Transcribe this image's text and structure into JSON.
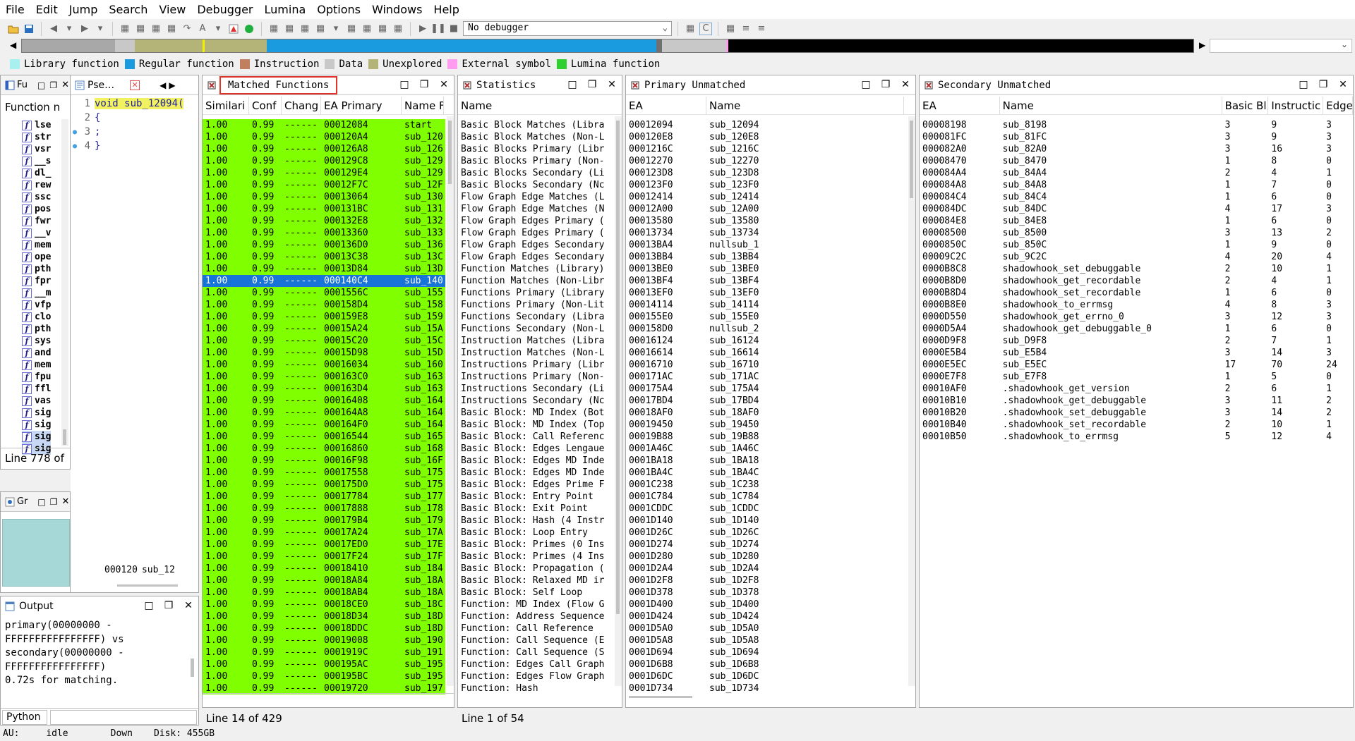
{
  "menu": [
    "File",
    "Edit",
    "Jump",
    "Search",
    "View",
    "Debugger",
    "Lumina",
    "Options",
    "Windows",
    "Help"
  ],
  "toolbar": {
    "debugger_value": "No debugger"
  },
  "legend": [
    {
      "label": "Library function",
      "color": "#a8f0f0"
    },
    {
      "label": "Regular function",
      "color": "#1a9be0"
    },
    {
      "label": "Instruction",
      "color": "#c08060"
    },
    {
      "label": "Data",
      "color": "#c8c8c8"
    },
    {
      "label": "Unexplored",
      "color": "#b4b478"
    },
    {
      "label": "External symbol",
      "color": "#ff9cf0"
    },
    {
      "label": "Lumina function",
      "color": "#30d030"
    }
  ],
  "colors": {
    "match_green": "#80ff00",
    "selected_blue": "#1874d6",
    "highlight_red": "#e0342a",
    "nav_blue": "#1a9be0",
    "nav_olive": "#b4b478"
  },
  "functions_panel": {
    "tab": "Fu",
    "header": "Function n",
    "items": [
      "lse",
      "str",
      "vsr",
      "__s",
      "dl_",
      "rew",
      "ssc",
      "pos",
      "fwr",
      "__v",
      "mem",
      "ope",
      "pth",
      "fpr",
      "__m",
      "vfp",
      "clo",
      "pth",
      "sys",
      "and",
      "mem",
      "fpu",
      "ffl",
      "vas",
      "sig",
      "sig",
      "sig",
      "sig"
    ],
    "status": "Line 778 of"
  },
  "graph_panel": {
    "tab": "Gr"
  },
  "pseudo_panel": {
    "tab": "Pse…",
    "lines": [
      {
        "num": "1",
        "code": "void sub_12094("
      },
      {
        "num": "2",
        "code": "{"
      },
      {
        "num": "3",
        "code": "  ;"
      },
      {
        "num": "4",
        "code": "}"
      }
    ],
    "footer_addr": "000120",
    "footer_name": "sub_12"
  },
  "output_panel": {
    "title": "Output",
    "lines": [
      "primary(00000000 -",
      "FFFFFFFFFFFFFFFF) vs",
      "secondary(00000000 -",
      "FFFFFFFFFFFFFFFF)",
      "0.72s for matching."
    ],
    "input_label": "Python"
  },
  "matched": {
    "title": "Matched Functions",
    "columns": [
      "Similari",
      "Conf",
      "Chang",
      "EA Primary",
      "Name F"
    ],
    "rows": [
      [
        "1.00",
        "0.99",
        "------",
        "00012084",
        "start"
      ],
      [
        "1.00",
        "0.99",
        "------",
        "000120A4",
        "sub_120"
      ],
      [
        "1.00",
        "0.99",
        "------",
        "000126A8",
        "sub_126"
      ],
      [
        "1.00",
        "0.99",
        "------",
        "000129C8",
        "sub_129"
      ],
      [
        "1.00",
        "0.99",
        "------",
        "000129E4",
        "sub_129"
      ],
      [
        "1.00",
        "0.99",
        "------",
        "00012F7C",
        "sub_12F"
      ],
      [
        "1.00",
        "0.99",
        "------",
        "00013064",
        "sub_130"
      ],
      [
        "1.00",
        "0.99",
        "------",
        "000131BC",
        "sub_131"
      ],
      [
        "1.00",
        "0.99",
        "------",
        "000132E8",
        "sub_132"
      ],
      [
        "1.00",
        "0.99",
        "------",
        "00013360",
        "sub_133"
      ],
      [
        "1.00",
        "0.99",
        "------",
        "000136D0",
        "sub_136"
      ],
      [
        "1.00",
        "0.99",
        "------",
        "00013C38",
        "sub_13C"
      ],
      [
        "1.00",
        "0.99",
        "------",
        "00013D84",
        "sub_13D"
      ],
      [
        "1.00",
        "0.99",
        "------",
        "000140C4",
        "sub_140"
      ],
      [
        "1.00",
        "0.99",
        "------",
        "0001556C",
        "sub_155"
      ],
      [
        "1.00",
        "0.99",
        "------",
        "000158D4",
        "sub_158"
      ],
      [
        "1.00",
        "0.99",
        "------",
        "000159E8",
        "sub_159"
      ],
      [
        "1.00",
        "0.99",
        "------",
        "00015A24",
        "sub_15A"
      ],
      [
        "1.00",
        "0.99",
        "------",
        "00015C20",
        "sub_15C"
      ],
      [
        "1.00",
        "0.99",
        "------",
        "00015D98",
        "sub_15D"
      ],
      [
        "1.00",
        "0.99",
        "------",
        "00016034",
        "sub_160"
      ],
      [
        "1.00",
        "0.99",
        "------",
        "000163C0",
        "sub_163"
      ],
      [
        "1.00",
        "0.99",
        "------",
        "000163D4",
        "sub_163"
      ],
      [
        "1.00",
        "0.99",
        "------",
        "00016408",
        "sub_164"
      ],
      [
        "1.00",
        "0.99",
        "------",
        "000164A8",
        "sub_164"
      ],
      [
        "1.00",
        "0.99",
        "------",
        "000164F0",
        "sub_164"
      ],
      [
        "1.00",
        "0.99",
        "------",
        "00016544",
        "sub_165"
      ],
      [
        "1.00",
        "0.99",
        "------",
        "00016860",
        "sub_168"
      ],
      [
        "1.00",
        "0.99",
        "------",
        "00016F98",
        "sub_16F"
      ],
      [
        "1.00",
        "0.99",
        "------",
        "00017558",
        "sub_175"
      ],
      [
        "1.00",
        "0.99",
        "------",
        "000175D0",
        "sub_175"
      ],
      [
        "1.00",
        "0.99",
        "------",
        "00017784",
        "sub_177"
      ],
      [
        "1.00",
        "0.99",
        "------",
        "00017888",
        "sub_178"
      ],
      [
        "1.00",
        "0.99",
        "------",
        "000179B4",
        "sub_179"
      ],
      [
        "1.00",
        "0.99",
        "------",
        "00017A24",
        "sub_17A"
      ],
      [
        "1.00",
        "0.99",
        "------",
        "00017ED0",
        "sub_17E"
      ],
      [
        "1.00",
        "0.99",
        "------",
        "00017F24",
        "sub_17F"
      ],
      [
        "1.00",
        "0.99",
        "------",
        "00018410",
        "sub_184"
      ],
      [
        "1.00",
        "0.99",
        "------",
        "00018A84",
        "sub_18A"
      ],
      [
        "1.00",
        "0.99",
        "------",
        "00018AB4",
        "sub_18A"
      ],
      [
        "1.00",
        "0.99",
        "------",
        "00018CE0",
        "sub_18C"
      ],
      [
        "1.00",
        "0.99",
        "------",
        "00018D34",
        "sub_18D"
      ],
      [
        "1.00",
        "0.99",
        "------",
        "00018DDC",
        "sub_18D"
      ],
      [
        "1.00",
        "0.99",
        "------",
        "00019008",
        "sub_190"
      ],
      [
        "1.00",
        "0.99",
        "------",
        "0001919C",
        "sub_191"
      ],
      [
        "1.00",
        "0.99",
        "------",
        "000195AC",
        "sub_195"
      ],
      [
        "1.00",
        "0.99",
        "------",
        "000195BC",
        "sub_195"
      ],
      [
        "1.00",
        "0.99",
        "------",
        "00019720",
        "sub_197"
      ]
    ],
    "selected_index": 13,
    "status": "Line 14 of 429"
  },
  "statistics": {
    "title": "Statistics",
    "column": "Name",
    "rows": [
      "Basic Block Matches (Libra",
      "Basic Block Matches (Non-L",
      "Basic Blocks Primary (Libr",
      "Basic Blocks Primary (Non-",
      "Basic Blocks Secondary (Li",
      "Basic Blocks Secondary (Nc",
      "Flow Graph Edge Matches (L",
      "Flow Graph Edge Matches (N",
      "Flow Graph Edges Primary (",
      "Flow Graph Edges Primary (",
      "Flow Graph Edges Secondary",
      "Flow Graph Edges Secondary",
      "Function Matches (Library)",
      "Function Matches (Non-Libr",
      "Functions Primary (Library",
      "Functions Primary (Non-Lit",
      "Functions Secondary (Libra",
      "Functions Secondary (Non-L",
      "Instruction Matches (Libra",
      "Instruction Matches (Non-L",
      "Instructions Primary (Libr",
      "Instructions Primary (Non-",
      "Instructions Secondary (Li",
      "Instructions Secondary (Nc",
      "Basic Block: MD Index (Bot",
      "Basic Block: MD Index (Top",
      "Basic Block: Call Referenc",
      "Basic Block: Edges Lengaue",
      "Basic Block: Edges MD Inde",
      "Basic Block: Edges MD Inde",
      "Basic Block: Edges Prime F",
      "Basic Block: Entry Point",
      "Basic Block: Exit Point",
      "Basic Block: Hash (4 Instr",
      "Basic Block: Loop Entry",
      "Basic Block: Primes (0 Ins",
      "Basic Block: Primes (4 Ins",
      "Basic Block: Propagation (",
      "Basic Block: Relaxed MD ir",
      "Basic Block: Self Loop",
      "Function: MD Index (Flow G",
      "Function: Address Sequence",
      "Function: Call Reference",
      "Function: Call Sequence (E",
      "Function: Call Sequence (S",
      "Function: Edges Call Graph",
      "Function: Edges Flow Graph",
      "Function: Hash"
    ],
    "status": "Line 1 of 54"
  },
  "primary_unmatched": {
    "title": "Primary Unmatched",
    "columns": [
      "EA",
      "Name"
    ],
    "rows": [
      [
        "00012094",
        "sub_12094"
      ],
      [
        "000120E8",
        "sub_120E8"
      ],
      [
        "0001216C",
        "sub_1216C"
      ],
      [
        "00012270",
        "sub_12270"
      ],
      [
        "000123D8",
        "sub_123D8"
      ],
      [
        "000123F0",
        "sub_123F0"
      ],
      [
        "00012414",
        "sub_12414"
      ],
      [
        "00012A00",
        "sub_12A00"
      ],
      [
        "00013580",
        "sub_13580"
      ],
      [
        "00013734",
        "sub_13734"
      ],
      [
        "00013BA4",
        "nullsub_1"
      ],
      [
        "00013BB4",
        "sub_13BB4"
      ],
      [
        "00013BE0",
        "sub_13BE0"
      ],
      [
        "00013BF4",
        "sub_13BF4"
      ],
      [
        "00013EF0",
        "sub_13EF0"
      ],
      [
        "00014114",
        "sub_14114"
      ],
      [
        "000155E0",
        "sub_155E0"
      ],
      [
        "000158D0",
        "nullsub_2"
      ],
      [
        "00016124",
        "sub_16124"
      ],
      [
        "00016614",
        "sub_16614"
      ],
      [
        "00016710",
        "sub_16710"
      ],
      [
        "000171AC",
        "sub_171AC"
      ],
      [
        "000175A4",
        "sub_175A4"
      ],
      [
        "00017BD4",
        "sub_17BD4"
      ],
      [
        "00018AF0",
        "sub_18AF0"
      ],
      [
        "00019450",
        "sub_19450"
      ],
      [
        "00019B88",
        "sub_19B88"
      ],
      [
        "0001A46C",
        "sub_1A46C"
      ],
      [
        "0001BA18",
        "sub_1BA18"
      ],
      [
        "0001BA4C",
        "sub_1BA4C"
      ],
      [
        "0001C238",
        "sub_1C238"
      ],
      [
        "0001C784",
        "sub_1C784"
      ],
      [
        "0001CDDC",
        "sub_1CDDC"
      ],
      [
        "0001D140",
        "sub_1D140"
      ],
      [
        "0001D26C",
        "sub_1D26C"
      ],
      [
        "0001D274",
        "sub_1D274"
      ],
      [
        "0001D280",
        "sub_1D280"
      ],
      [
        "0001D2A4",
        "sub_1D2A4"
      ],
      [
        "0001D2F8",
        "sub_1D2F8"
      ],
      [
        "0001D378",
        "sub_1D378"
      ],
      [
        "0001D400",
        "sub_1D400"
      ],
      [
        "0001D424",
        "sub_1D424"
      ],
      [
        "0001D5A0",
        "sub_1D5A0"
      ],
      [
        "0001D5A8",
        "sub_1D5A8"
      ],
      [
        "0001D694",
        "sub_1D694"
      ],
      [
        "0001D6B8",
        "sub_1D6B8"
      ],
      [
        "0001D6DC",
        "sub_1D6DC"
      ],
      [
        "0001D734",
        "sub_1D734"
      ]
    ]
  },
  "secondary_unmatched": {
    "title": "Secondary Unmatched",
    "columns": [
      "EA",
      "Name",
      "Basic Bl",
      "Instructic",
      "Edges"
    ],
    "rows": [
      [
        "00008198",
        "sub_8198",
        "3",
        "9",
        "3"
      ],
      [
        "000081FC",
        "sub_81FC",
        "3",
        "9",
        "3"
      ],
      [
        "000082A0",
        "sub_82A0",
        "3",
        "16",
        "3"
      ],
      [
        "00008470",
        "sub_8470",
        "1",
        "8",
        "0"
      ],
      [
        "000084A4",
        "sub_84A4",
        "2",
        "4",
        "1"
      ],
      [
        "000084A8",
        "sub_84A8",
        "1",
        "7",
        "0"
      ],
      [
        "000084C4",
        "sub_84C4",
        "1",
        "6",
        "0"
      ],
      [
        "000084DC",
        "sub_84DC",
        "4",
        "17",
        "3"
      ],
      [
        "000084E8",
        "sub_84E8",
        "1",
        "6",
        "0"
      ],
      [
        "00008500",
        "sub_8500",
        "3",
        "13",
        "2"
      ],
      [
        "0000850C",
        "sub_850C",
        "1",
        "9",
        "0"
      ],
      [
        "00009C2C",
        "sub_9C2C",
        "4",
        "20",
        "4"
      ],
      [
        "0000B8C8",
        "shadowhook_set_debuggable",
        "2",
        "10",
        "1"
      ],
      [
        "0000B8D0",
        "shadowhook_get_recordable",
        "2",
        "4",
        "1"
      ],
      [
        "0000B8D4",
        "shadowhook_set_recordable",
        "1",
        "6",
        "0"
      ],
      [
        "0000B8E0",
        "shadowhook_to_errmsg",
        "4",
        "8",
        "3"
      ],
      [
        "0000D550",
        "shadowhook_get_errno_0",
        "3",
        "12",
        "3"
      ],
      [
        "0000D5A4",
        "shadowhook_get_debuggable_0",
        "1",
        "6",
        "0"
      ],
      [
        "0000D9F8",
        "sub_D9F8",
        "2",
        "7",
        "1"
      ],
      [
        "0000E5B4",
        "sub_E5B4",
        "3",
        "14",
        "3"
      ],
      [
        "0000E5EC",
        "sub_E5EC",
        "17",
        "70",
        "24"
      ],
      [
        "0000E7F8",
        "sub_E7F8",
        "1",
        "5",
        "0"
      ],
      [
        "00010AF0",
        ".shadowhook_get_version",
        "2",
        "6",
        "1"
      ],
      [
        "00010B10",
        ".shadowhook_get_debuggable",
        "3",
        "11",
        "2"
      ],
      [
        "00010B20",
        ".shadowhook_set_debuggable",
        "3",
        "14",
        "2"
      ],
      [
        "00010B40",
        ".shadowhook_set_recordable",
        "2",
        "10",
        "1"
      ],
      [
        "00010B50",
        ".shadowhook_to_errmsg",
        "5",
        "12",
        "4"
      ]
    ]
  },
  "statusbar": {
    "au": "AU:",
    "au_state": "idle",
    "dir": "Down",
    "disk": "Disk: 455GB"
  }
}
